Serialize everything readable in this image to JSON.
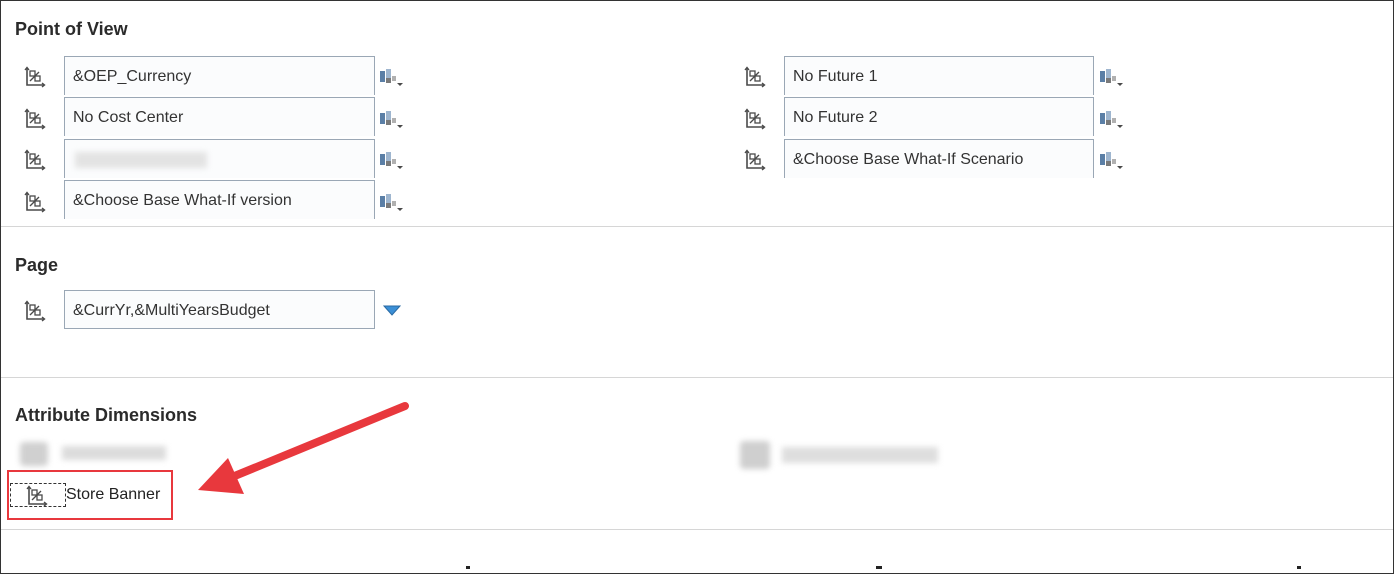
{
  "point_of_view": {
    "title": "Point of View",
    "left_fields": [
      "&OEP_Currency",
      "No Cost Center",
      "",
      "&Choose Base What-If version"
    ],
    "right_fields": [
      "No Future 1",
      "No Future 2",
      "&Choose Base What-If Scenario"
    ]
  },
  "page": {
    "title": "Page",
    "field": "&CurrYr,&MultiYearsBudget"
  },
  "attribute_dimensions": {
    "title": "Attribute Dimensions",
    "highlighted_item": "Store Banner"
  },
  "icons": {
    "dimension": "dimension-hierarchy-icon",
    "member_selector": "member-selector-icon",
    "dropdown": "dropdown-arrow-icon"
  },
  "colors": {
    "annotation": "#e8383d",
    "dropdown": "#3b8fd6"
  }
}
